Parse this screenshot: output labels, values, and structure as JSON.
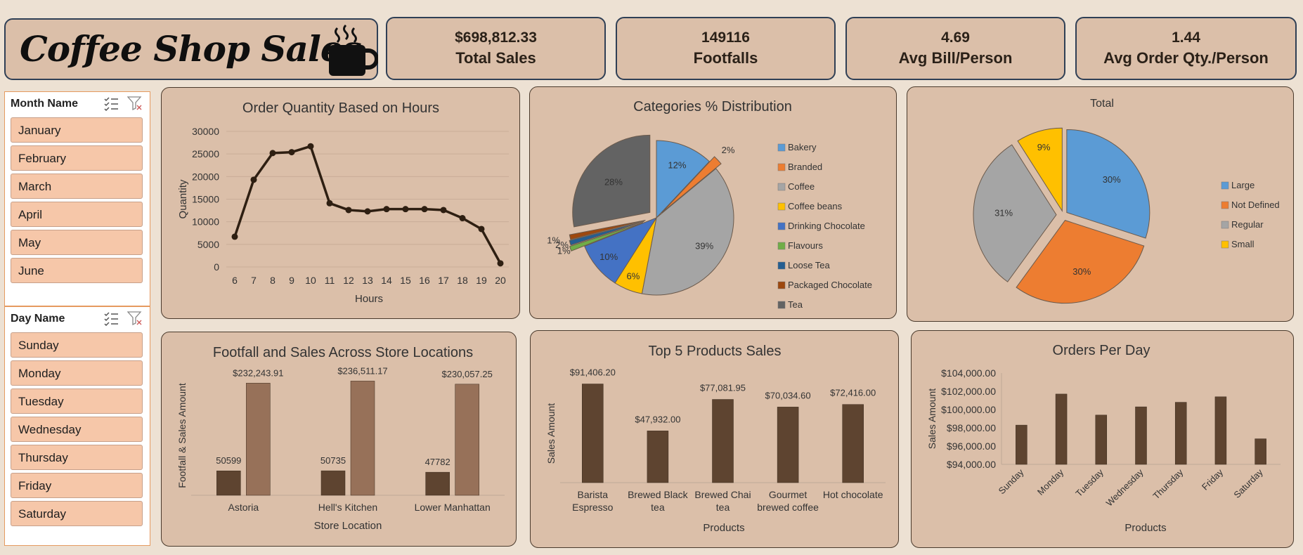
{
  "header": {
    "title": "Coffee Shop Sales"
  },
  "kpis": [
    {
      "value": "$698,812.33",
      "label": "Total Sales"
    },
    {
      "value": "149116",
      "label": "Footfalls"
    },
    {
      "value": "4.69",
      "label": "Avg Bill/Person"
    },
    {
      "value": "1.44",
      "label": "Avg Order Qty./Person"
    }
  ],
  "month_slicer": {
    "header": "Month Name",
    "items": [
      "January",
      "February",
      "March",
      "April",
      "May",
      "June"
    ]
  },
  "day_slicer": {
    "header": "Day Name",
    "items": [
      "Sunday",
      "Monday",
      "Tuesday",
      "Wednesday",
      "Thursday",
      "Friday",
      "Saturday"
    ]
  },
  "chart_data": [
    {
      "id": "hours",
      "type": "line",
      "title": "Order Quantity Based on Hours",
      "xlabel": "Hours",
      "ylabel": "Quantity",
      "x": [
        6,
        7,
        8,
        9,
        10,
        11,
        12,
        13,
        14,
        15,
        16,
        17,
        18,
        19,
        20
      ],
      "y": [
        6700,
        19300,
        25200,
        25400,
        26700,
        14100,
        12600,
        12300,
        12800,
        12800,
        12800,
        12600,
        10800,
        8400,
        800
      ],
      "ylim": [
        0,
        30000
      ],
      "yticks": [
        "30000",
        "25000",
        "20000",
        "15000",
        "10000",
        "5000",
        "0"
      ],
      "color": "#2e1f12",
      "grid": true
    },
    {
      "id": "categories",
      "type": "pie",
      "title": "Categories % Distribution",
      "legend_position": "right",
      "slices": [
        {
          "name": "Bakery",
          "value": 12,
          "label": "12%",
          "color": "#5b9bd5"
        },
        {
          "name": "Branded",
          "value": 2,
          "label": "2%",
          "color": "#ed7d31"
        },
        {
          "name": "Coffee",
          "value": 39,
          "label": "39%",
          "color": "#a5a5a5"
        },
        {
          "name": "Coffee beans",
          "value": 6,
          "label": "6%",
          "color": "#ffc000"
        },
        {
          "name": "Drinking Chocolate",
          "value": 10,
          "label": "10%",
          "color": "#4472c4"
        },
        {
          "name": "Flavours",
          "value": 1,
          "label": "1%",
          "color": "#70ad47"
        },
        {
          "name": "Loose Tea",
          "value": 1,
          "label": "2%",
          "color": "#255e91"
        },
        {
          "name": "Packaged Chocolate",
          "value": 1,
          "label": "1%",
          "color": "#9e480e"
        },
        {
          "name": "Tea",
          "value": 28,
          "label": "28%",
          "color": "#636363"
        }
      ]
    },
    {
      "id": "sizes",
      "type": "pie",
      "title": "Total",
      "legend_position": "right",
      "slices": [
        {
          "name": "Large",
          "value": 30,
          "label": "30%",
          "color": "#5b9bd5"
        },
        {
          "name": "Not Defined",
          "value": 30,
          "label": "30%",
          "color": "#ed7d31"
        },
        {
          "name": "Regular",
          "value": 31,
          "label": "31%",
          "color": "#a5a5a5"
        },
        {
          "name": "Small",
          "value": 9,
          "label": "9%",
          "color": "#ffc000"
        }
      ]
    },
    {
      "id": "stores",
      "type": "bar",
      "title": "Footfall and Sales Across Store Locations",
      "xlabel": "Store Location",
      "ylabel": "Footfall & Sales Amount",
      "categories": [
        "Astoria",
        "Hell's Kitchen",
        "Lower Manhattan"
      ],
      "series": [
        {
          "values": [
            50599,
            50735,
            47782
          ],
          "labels": [
            "50599",
            "50735",
            "47782"
          ],
          "color": "#5e4430"
        },
        {
          "values": [
            232243.91,
            236511.17,
            230057.25
          ],
          "labels": [
            "$232,243.91",
            "$236,511.17",
            "$230,057.25"
          ],
          "color": "#977159"
        }
      ],
      "ylim": [
        0,
        240000
      ]
    },
    {
      "id": "products",
      "type": "bar",
      "title": "Top 5 Products Sales",
      "xlabel": "Products",
      "ylabel": "Sales Amount",
      "categories": [
        [
          "Barista",
          "Espresso"
        ],
        [
          "Brewed Black",
          "tea"
        ],
        [
          "Brewed Chai",
          "tea"
        ],
        [
          "Gourmet",
          "brewed coffee"
        ],
        [
          "Hot chocolate"
        ]
      ],
      "values": [
        91406.2,
        47932.0,
        77081.95,
        70034.6,
        72416.0
      ],
      "labels": [
        "$91,406.20",
        "$47,932.00",
        "$77,081.95",
        "$70,034.60",
        "$72,416.00"
      ],
      "ylim": [
        0,
        95000
      ],
      "color": "#5e4430"
    },
    {
      "id": "days",
      "type": "bar",
      "title": "Orders Per Day",
      "xlabel": "Products",
      "ylabel": "Sales Amount",
      "categories": [
        "Sunday",
        "Monday",
        "Tuesday",
        "Wednesday",
        "Thursday",
        "Friday",
        "Saturday"
      ],
      "values": [
        98300,
        101700,
        99400,
        100300,
        100800,
        101400,
        96800
      ],
      "ylim": [
        94000,
        104000
      ],
      "yticks": [
        "$104,000.00",
        "$102,000.00",
        "$100,000.00",
        "$98,000.00",
        "$96,000.00",
        "$94,000.00"
      ],
      "color": "#5e4430"
    }
  ]
}
